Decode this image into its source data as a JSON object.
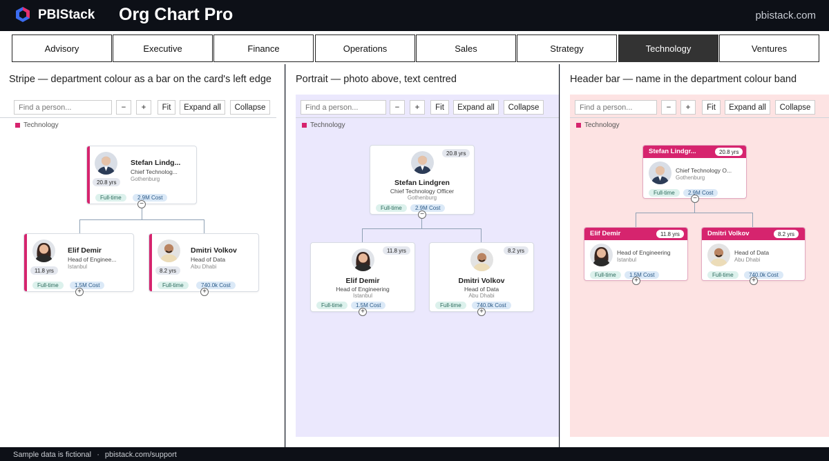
{
  "app": {
    "brand": "PBIStack",
    "title": "Org Chart Pro",
    "site": "pbistack.com",
    "accent": "#d6246e"
  },
  "tabs": [
    {
      "label": "Advisory"
    },
    {
      "label": "Executive"
    },
    {
      "label": "Finance"
    },
    {
      "label": "Operations"
    },
    {
      "label": "Sales"
    },
    {
      "label": "Strategy"
    },
    {
      "label": "Technology",
      "active": true
    },
    {
      "label": "Ventures"
    }
  ],
  "toolbar": {
    "search_placeholder": "Find a person...",
    "minus": "−",
    "plus": "+",
    "fit": "Fit",
    "expand": "Expand all",
    "collapse": "Collapse"
  },
  "legend": {
    "label": "Technology",
    "color": "#d6246e"
  },
  "panels": [
    {
      "title": "Stripe — department colour as a bar on the card's left edge",
      "background": "#ffffff"
    },
    {
      "title": "Portrait — photo above, text centred",
      "background": "#ebe8fd"
    },
    {
      "title": "Header bar — name in the department colour band",
      "background": "#fde3e3"
    }
  ],
  "people": {
    "root": {
      "name": "Stefan Lindgren",
      "name_short": "Stefan Lindg...",
      "name_band": "Stefan Lindgr...",
      "role": "Chief Technology Officer",
      "role_short": "Chief Technolog...",
      "role_band": "Chief Technology O...",
      "location": "Gothenburg",
      "tenure": "20.8 yrs",
      "type": "Full-time",
      "cost": "2.9M Cost",
      "toggle": "−"
    },
    "elif": {
      "name": "Elif Demir",
      "role": "Head of Engineering",
      "role_short": "Head of Enginee...",
      "location": "Istanbul",
      "tenure": "11.8 yrs",
      "type": "Full-time",
      "cost": "1.5M Cost",
      "toggle": "+"
    },
    "dmitri": {
      "name": "Dmitri Volkov",
      "role": "Head of Data",
      "location": "Abu Dhabi",
      "tenure": "8.2 yrs",
      "type": "Full-time",
      "cost": "740.0k Cost",
      "toggle": "+"
    }
  },
  "footer": {
    "text": "Sample data is fictional",
    "sep": "·",
    "link": "pbistack.com/support"
  },
  "icons": [
    "logo-hexagon-icon",
    "stefan-portrait-icon",
    "elif-portrait-icon",
    "dmitri-portrait-icon"
  ]
}
